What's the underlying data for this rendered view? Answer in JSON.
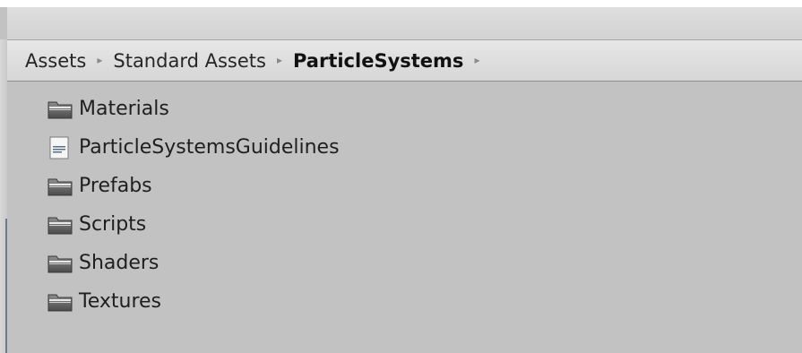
{
  "breadcrumb": {
    "items": [
      {
        "label": "Assets"
      },
      {
        "label": "Standard Assets"
      },
      {
        "label": "ParticleSystems"
      }
    ],
    "separator": "▸"
  },
  "files": [
    {
      "name": "Materials",
      "icon": "folder-icon"
    },
    {
      "name": "ParticleSystemsGuidelines",
      "icon": "document-icon"
    },
    {
      "name": "Prefabs",
      "icon": "folder-icon"
    },
    {
      "name": "Scripts",
      "icon": "folder-icon"
    },
    {
      "name": "Shaders",
      "icon": "folder-icon"
    },
    {
      "name": "Textures",
      "icon": "folder-icon"
    }
  ]
}
